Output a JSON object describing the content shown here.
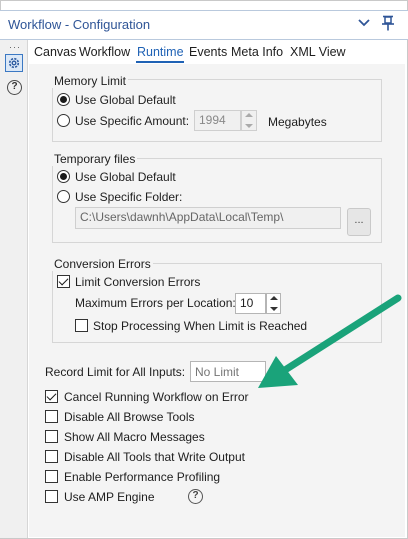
{
  "window": {
    "title": "Workflow - Configuration",
    "more_glyph": "···"
  },
  "tabs": [
    "Canvas",
    "Workflow",
    "Runtime",
    "Events",
    "Meta Info",
    "XML View"
  ],
  "active_tab": "Runtime",
  "sidebar": {
    "icons": [
      "gear-icon",
      "help-icon"
    ],
    "help_glyph": "?"
  },
  "memory_limit": {
    "label": "Memory Limit",
    "option_global": "Use Global Default",
    "option_specific": "Use Specific Amount:",
    "amount": "1994",
    "unit": "Megabytes",
    "selected": "global"
  },
  "temporary_files": {
    "label": "Temporary files",
    "option_global": "Use Global Default",
    "option_specific": "Use Specific Folder:",
    "folder": "C:\\Users\\dawnh\\AppData\\Local\\Temp\\",
    "browse": "...",
    "selected": "global"
  },
  "conversion_errors": {
    "label": "Conversion Errors",
    "limit_label": "Limit Conversion Errors",
    "limit_checked": true,
    "max_label": "Maximum Errors per Location:",
    "max_value": "10",
    "stop_label": "Stop Processing When Limit is Reached",
    "stop_checked": false
  },
  "record_limit": {
    "label": "Record Limit for All Inputs:",
    "placeholder": "No Limit"
  },
  "options": [
    {
      "label": "Cancel Running Workflow on Error",
      "checked": true
    },
    {
      "label": "Disable All Browse Tools",
      "checked": false
    },
    {
      "label": "Show All Macro Messages",
      "checked": false
    },
    {
      "label": "Disable All Tools that Write Output",
      "checked": false
    },
    {
      "label": "Enable Performance Profiling",
      "checked": false
    },
    {
      "label": "Use AMP Engine",
      "checked": false
    }
  ],
  "colors": {
    "accent": "#1f62b5",
    "title": "#2f5597",
    "annotation_arrow": "#1aa37a"
  }
}
